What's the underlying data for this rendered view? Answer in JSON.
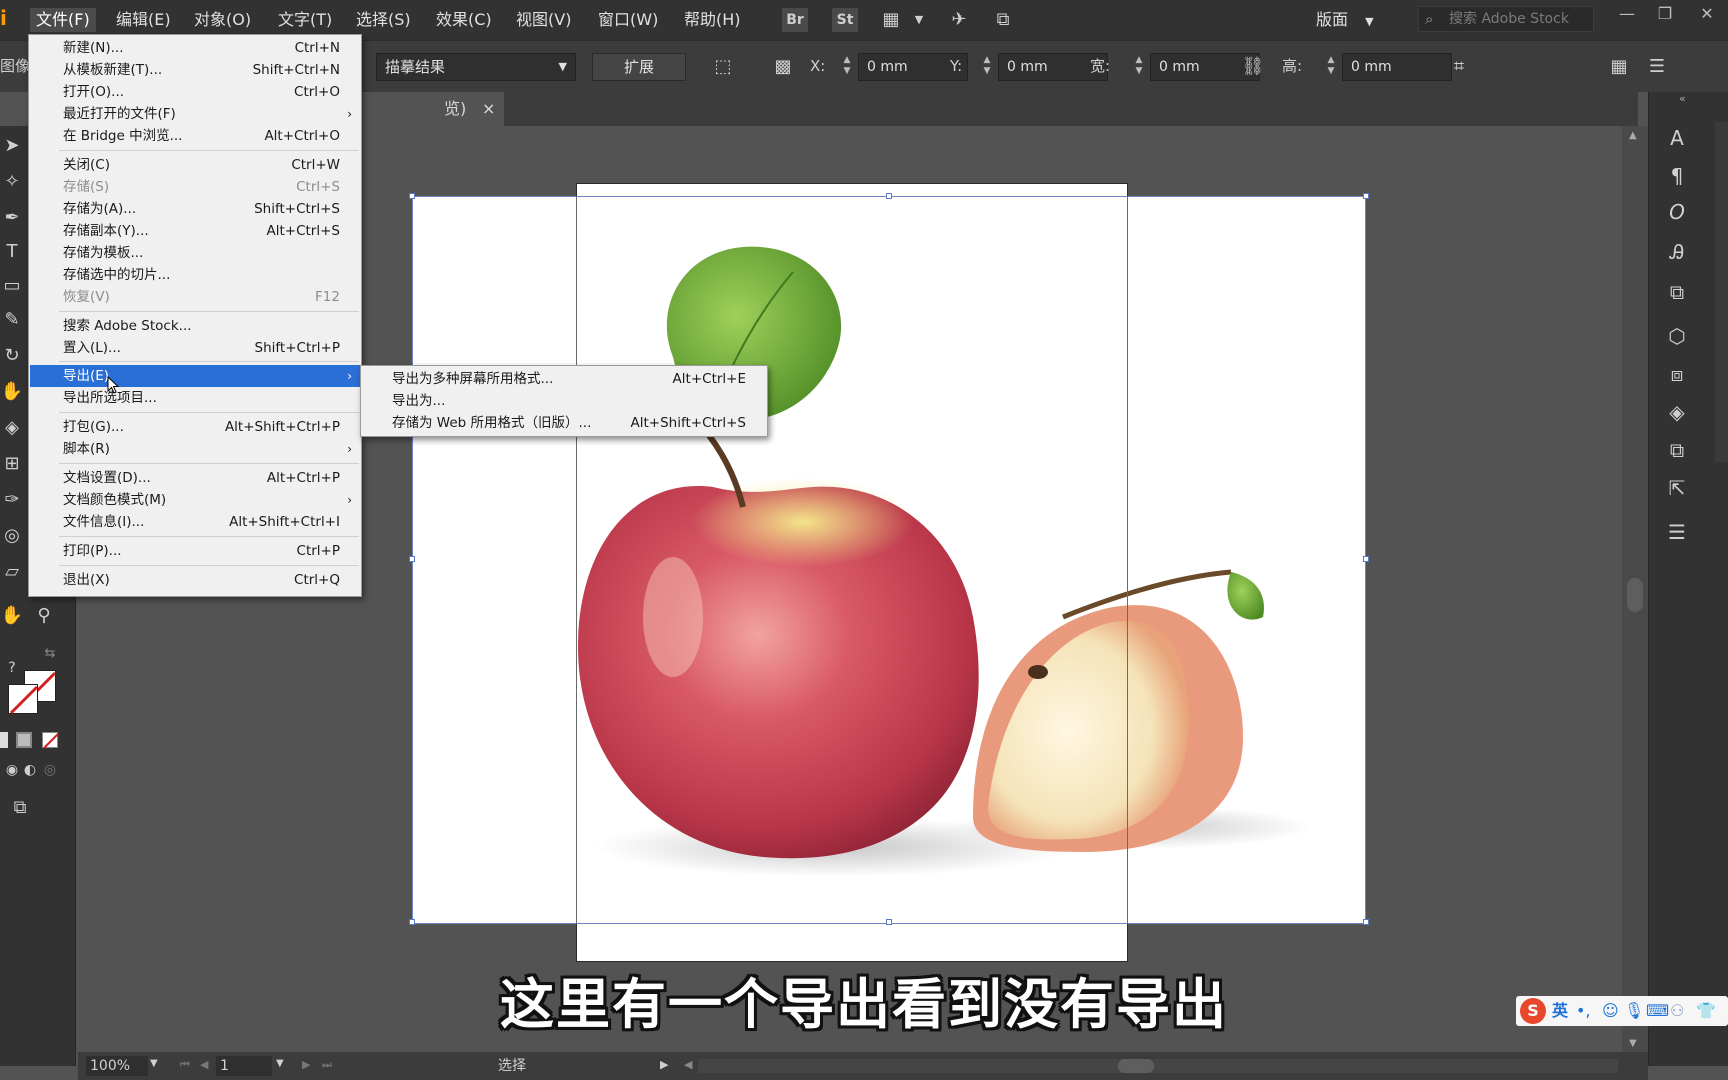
{
  "menubar": {
    "items": [
      "文件(F)",
      "编辑(E)",
      "对象(O)",
      "文字(T)",
      "选择(S)",
      "效果(C)",
      "视图(V)",
      "窗口(W)",
      "帮助(H)"
    ],
    "bridge_label": "Br",
    "stock_label": "St",
    "workspace_label": "版面",
    "search_placeholder": "搜索 Adobe Stock"
  },
  "controlbar": {
    "left_label": "图像",
    "trace_select": "描摹结果",
    "expand_button": "扩展",
    "x_label": "X:",
    "x_value": "0 mm",
    "y_label": "Y:",
    "y_value": "0 mm",
    "w_label": "宽:",
    "w_value": "0 mm",
    "h_label": "高:",
    "h_value": "0 mm"
  },
  "tab": {
    "label": "览)",
    "close": "×"
  },
  "file_menu": {
    "items": [
      {
        "label": "新建(N)...",
        "shortcut": "Ctrl+N"
      },
      {
        "label": "从模板新建(T)...",
        "shortcut": "Shift+Ctrl+N"
      },
      {
        "label": "打开(O)...",
        "shortcut": "Ctrl+O"
      },
      {
        "label": "最近打开的文件(F)",
        "shortcut": "›"
      },
      {
        "label": "在 Bridge 中浏览...",
        "shortcut": "Alt+Ctrl+O"
      },
      {
        "label": "关闭(C)",
        "shortcut": "Ctrl+W"
      },
      {
        "label": "存储(S)",
        "shortcut": "Ctrl+S"
      },
      {
        "label": "存储为(A)...",
        "shortcut": "Shift+Ctrl+S"
      },
      {
        "label": "存储副本(Y)...",
        "shortcut": "Alt+Ctrl+S"
      },
      {
        "label": "存储为模板...",
        "shortcut": ""
      },
      {
        "label": "存储选中的切片...",
        "shortcut": ""
      },
      {
        "label": "恢复(V)",
        "shortcut": "F12"
      },
      {
        "label": "搜索 Adobe Stock...",
        "shortcut": ""
      },
      {
        "label": "置入(L)...",
        "shortcut": "Shift+Ctrl+P"
      },
      {
        "label": "导出(E)",
        "shortcut": "›"
      },
      {
        "label": "导出所选项目...",
        "shortcut": ""
      },
      {
        "label": "打包(G)...",
        "shortcut": "Alt+Shift+Ctrl+P"
      },
      {
        "label": "脚本(R)",
        "shortcut": "›"
      },
      {
        "label": "文档设置(D)...",
        "shortcut": "Alt+Ctrl+P"
      },
      {
        "label": "文档颜色模式(M)",
        "shortcut": "›"
      },
      {
        "label": "文件信息(I)...",
        "shortcut": "Alt+Shift+Ctrl+I"
      },
      {
        "label": "打印(P)...",
        "shortcut": "Ctrl+P"
      },
      {
        "label": "退出(X)",
        "shortcut": "Ctrl+Q"
      }
    ]
  },
  "export_submenu": {
    "items": [
      {
        "label": "导出为多种屏幕所用格式...",
        "shortcut": "Alt+Ctrl+E"
      },
      {
        "label": "导出为...",
        "shortcut": ""
      },
      {
        "label": "存储为 Web 所用格式（旧版）...",
        "shortcut": "Alt+Shift+Ctrl+S"
      }
    ]
  },
  "statusbar": {
    "zoom": "100%",
    "artboard": "1",
    "tool": "选择"
  },
  "subtitle": "这里有一个导出看到没有导出",
  "ime": {
    "mode": "英"
  },
  "colors": {
    "highlight": "#2a6fd6",
    "menu_bg": "#f0f0f0",
    "ui_dark": "#323232",
    "canvas": "#535353"
  }
}
